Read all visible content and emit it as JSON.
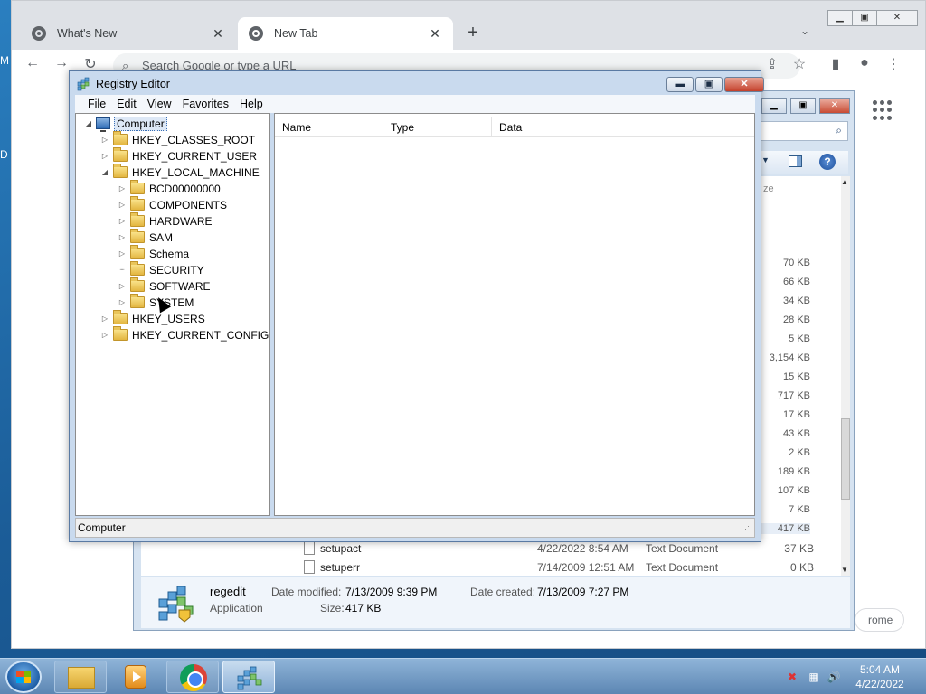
{
  "desktop": {
    "mark_top": "M",
    "mark_left": "D"
  },
  "chrome": {
    "tabs": [
      {
        "label": "What's New",
        "close": "✕"
      },
      {
        "label": "New Tab",
        "close": "✕"
      }
    ],
    "new_tab": "+",
    "tab_search": "⌄",
    "controls": {
      "minimize": "▁",
      "maximize": "▣",
      "close": "✕"
    },
    "toolbar": {
      "back": "←",
      "forward": "→",
      "reload": "↻",
      "share": "⇪",
      "bookmark": "☆",
      "side_panel": "▮",
      "profile": "●",
      "menu": "⋮"
    },
    "omnibox": {
      "placeholder": "Search Google or type a URL",
      "icon": "⌕"
    },
    "customize_chip": "rome"
  },
  "explorer": {
    "controls": {
      "minimize": "▁",
      "maximize": "▣",
      "close": "✕"
    },
    "search_icon": "⌕",
    "help_icon": "?",
    "size_header": "ze",
    "sizes": [
      "70 KB",
      "66 KB",
      "34 KB",
      "28 KB",
      "5 KB",
      "3,154 KB",
      "15 KB",
      "717 KB",
      "17 KB",
      "43 KB",
      "2 KB",
      "189 KB",
      "107 KB",
      "7 KB",
      "417 KB"
    ],
    "files": [
      {
        "name": "setupact",
        "date": "4/22/2022 8:54 AM",
        "type": "Text Document",
        "size": "37 KB"
      },
      {
        "name": "setuperr",
        "date": "7/14/2009 12:51 AM",
        "type": "Text Document",
        "size": "0 KB"
      }
    ],
    "details": {
      "name": "regedit",
      "kind": "Application",
      "modified_label": "Date modified:",
      "modified_value": "7/13/2009 9:39 PM",
      "created_label": "Date created:",
      "created_value": "7/13/2009 7:27 PM",
      "size_label": "Size:",
      "size_value": "417 KB"
    }
  },
  "regedit": {
    "title": "Registry Editor",
    "controls": {
      "minimize": "▬",
      "maximize": "▣",
      "close": "✕"
    },
    "menu": [
      "File",
      "Edit",
      "View",
      "Favorites",
      "Help"
    ],
    "tree": {
      "root": "Computer",
      "hives": [
        "HKEY_CLASSES_ROOT",
        "HKEY_CURRENT_USER",
        "HKEY_LOCAL_MACHINE"
      ],
      "hklm_children": [
        "BCD00000000",
        "COMPONENTS",
        "HARDWARE",
        "SAM",
        "Schema",
        "SECURITY",
        "SOFTWARE",
        "SYSTEM"
      ],
      "hives_after": [
        "HKEY_USERS",
        "HKEY_CURRENT_CONFIG"
      ]
    },
    "columns": [
      "Name",
      "Type",
      "Data"
    ],
    "status": "Computer"
  },
  "taskbar": {
    "clock_time": "5:04 AM",
    "clock_date": "4/22/2022",
    "tray_icons": [
      "✖",
      "▦",
      "🔊"
    ]
  }
}
